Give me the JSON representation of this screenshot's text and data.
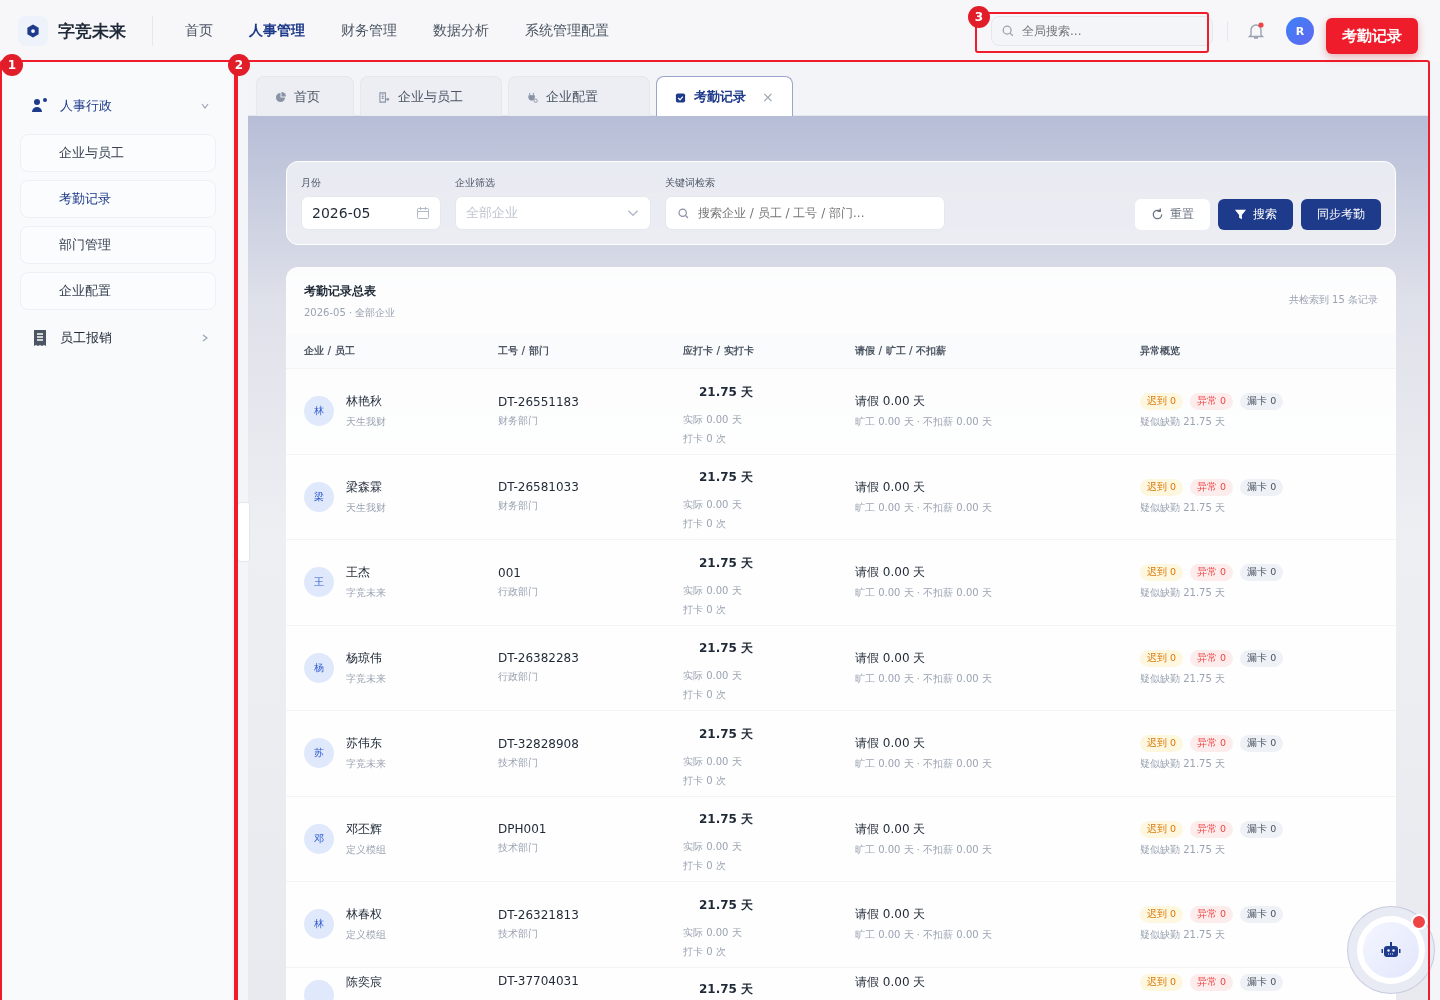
{
  "brand": "字竞未来",
  "nav": [
    {
      "label": "首页",
      "selected": false
    },
    {
      "label": "人事管理",
      "selected": true
    },
    {
      "label": "财务管理",
      "selected": false
    },
    {
      "label": "数据分析",
      "selected": false
    },
    {
      "label": "系统管理配置",
      "selected": false
    }
  ],
  "global_search": {
    "placeholder": "全局搜索..."
  },
  "notifications": {
    "unread": true
  },
  "avatar": {
    "initial": "R"
  },
  "sidebar": {
    "groups": [
      {
        "label": "人事行政",
        "kind": "people",
        "expanded": true,
        "children": [
          {
            "label": "企业与员工",
            "selected": false
          },
          {
            "label": "考勤记录",
            "selected": true
          },
          {
            "label": "部门管理",
            "selected": false
          },
          {
            "label": "企业配置",
            "selected": false
          }
        ]
      },
      {
        "label": "员工报销",
        "kind": "receipt",
        "expanded": false
      }
    ]
  },
  "tabs": [
    {
      "label": "首页",
      "kind": "chart",
      "selected": false,
      "closable": false
    },
    {
      "label": "企业与员工",
      "kind": "org",
      "selected": false,
      "closable": false
    },
    {
      "label": "企业配置",
      "kind": "plug",
      "selected": false,
      "closable": false
    },
    {
      "label": "考勤记录",
      "kind": "check",
      "selected": true,
      "closable": true,
      "close": "×"
    }
  ],
  "filters": {
    "month": {
      "label": "月份",
      "value": "2026-05"
    },
    "company": {
      "label": "企业筛选",
      "placeholder": "全部企业"
    },
    "keyword": {
      "label": "关键词检索",
      "placeholder": "搜索企业 / 员工 / 工号 / 部门..."
    },
    "buttons": [
      {
        "label": "重置",
        "kind": "reset"
      },
      {
        "label": "搜索",
        "kind": "search"
      },
      {
        "label": "同步考勤",
        "kind": "primary"
      }
    ]
  },
  "table": {
    "title": "考勤记录总表",
    "subtitle": "2026-05 · 全部企业",
    "count": "共检索到 15 条记录",
    "columns": [
      "企业 / 员工",
      "工号 / 部门",
      "应打卡 / 实打卡",
      "请假 / 旷工 / 不扣薪",
      "异常概览"
    ],
    "rows": [
      {
        "initial": "林",
        "name": "林艳秋",
        "company": "天生我财",
        "id": "DT-26551183",
        "dept": "财务部门",
        "due": "21.75 天",
        "actual": "实际 0.00 天",
        "punches": "打卡 0 次",
        "leave": "请假 0.00 天",
        "absence": "旷工 0.00 天 · 不扣薪 0.00 天",
        "late": "迟到 0",
        "abnormal": "异常 0",
        "missed": "漏卡 0",
        "suspect": "疑似缺勤 21.75 天"
      },
      {
        "initial": "梁",
        "name": "梁森霖",
        "company": "天生我财",
        "id": "DT-26581033",
        "dept": "财务部门",
        "due": "21.75 天",
        "actual": "实际 0.00 天",
        "punches": "打卡 0 次",
        "leave": "请假 0.00 天",
        "absence": "旷工 0.00 天 · 不扣薪 0.00 天",
        "late": "迟到 0",
        "abnormal": "异常 0",
        "missed": "漏卡 0",
        "suspect": "疑似缺勤 21.75 天"
      },
      {
        "initial": "王",
        "name": "王杰",
        "company": "字竞未来",
        "id": "001",
        "dept": "行政部门",
        "due": "21.75 天",
        "actual": "实际 0.00 天",
        "punches": "打卡 0 次",
        "leave": "请假 0.00 天",
        "absence": "旷工 0.00 天 · 不扣薪 0.00 天",
        "late": "迟到 0",
        "abnormal": "异常 0",
        "missed": "漏卡 0",
        "suspect": "疑似缺勤 21.75 天"
      },
      {
        "initial": "杨",
        "name": "杨琼伟",
        "company": "字竞未来",
        "id": "DT-26382283",
        "dept": "行政部门",
        "due": "21.75 天",
        "actual": "实际 0.00 天",
        "punches": "打卡 0 次",
        "leave": "请假 0.00 天",
        "absence": "旷工 0.00 天 · 不扣薪 0.00 天",
        "late": "迟到 0",
        "abnormal": "异常 0",
        "missed": "漏卡 0",
        "suspect": "疑似缺勤 21.75 天"
      },
      {
        "initial": "苏",
        "name": "苏伟东",
        "company": "字竞未来",
        "id": "DT-32828908",
        "dept": "技术部门",
        "due": "21.75 天",
        "actual": "实际 0.00 天",
        "punches": "打卡 0 次",
        "leave": "请假 0.00 天",
        "absence": "旷工 0.00 天 · 不扣薪 0.00 天",
        "late": "迟到 0",
        "abnormal": "异常 0",
        "missed": "漏卡 0",
        "suspect": "疑似缺勤 21.75 天"
      },
      {
        "initial": "邓",
        "name": "邓丕辉",
        "company": "定义模组",
        "id": "DPH001",
        "dept": "技术部门",
        "due": "21.75 天",
        "actual": "实际 0.00 天",
        "punches": "打卡 0 次",
        "leave": "请假 0.00 天",
        "absence": "旷工 0.00 天 · 不扣薪 0.00 天",
        "late": "迟到 0",
        "abnormal": "异常 0",
        "missed": "漏卡 0",
        "suspect": "疑似缺勤 21.75 天"
      },
      {
        "initial": "林",
        "name": "林春权",
        "company": "定义模组",
        "id": "DT-26321813",
        "dept": "技术部门",
        "due": "21.75 天",
        "actual": "实际 0.00 天",
        "punches": "打卡 0 次",
        "leave": "请假 0.00 天",
        "absence": "旷工 0.00 天 · 不扣薪 0.00 天",
        "late": "迟到 0",
        "abnormal": "异常 0",
        "missed": "漏卡 0",
        "suspect": "疑似缺勤 21.75 天"
      },
      {
        "name": "陈奕宸",
        "id": "DT-37704031",
        "due": "21.75 天",
        "leave": "请假 0.00 天",
        "late": "迟到 0",
        "abnormal": "异常 0",
        "missed": "漏卡 0"
      }
    ]
  },
  "assistant": {
    "unread": true
  },
  "annotations": [
    {
      "number": "1",
      "kind": "sidebar"
    },
    {
      "number": "2",
      "kind": "main"
    },
    {
      "number": "3",
      "kind": "search"
    }
  ],
  "callout": "考勤记录"
}
